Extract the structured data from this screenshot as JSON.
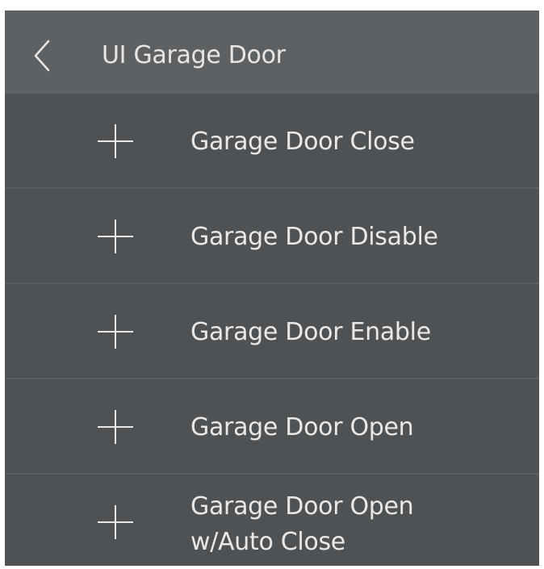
{
  "header": {
    "title": "UI Garage Door",
    "back_icon": "chevron-left-icon"
  },
  "items": [
    {
      "label": "Garage Door Close",
      "icon": "plus-icon"
    },
    {
      "label": "Garage Door Disable",
      "icon": "plus-icon"
    },
    {
      "label": "Garage Door Enable",
      "icon": "plus-icon"
    },
    {
      "label": "Garage Door Open",
      "icon": "plus-icon"
    },
    {
      "label_line1": "Garage Door Open",
      "label_line2": "w/Auto Close",
      "icon": "plus-icon"
    }
  ],
  "colors": {
    "header_bg": "#5e6163",
    "list_bg": "#4f5254",
    "divider": "#5c5f61",
    "text": "#e9e9e9"
  }
}
